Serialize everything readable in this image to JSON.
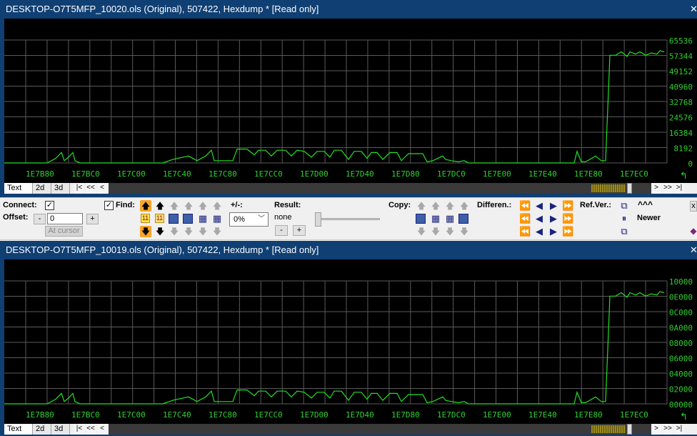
{
  "colors": {
    "title_bg": "#0f3f73",
    "graph_bg": "#000000",
    "grid": "#5a5a5a",
    "trace": "#22e022",
    "axis_text": "#2fd02f",
    "highlight": "#f7a52a",
    "navy": "#1a237e"
  },
  "panels": [
    {
      "title": "DESKTOP-O7T5MFP_10020.ols (Original), 507422, Hexdump *    [Read only]",
      "x_labels": [
        "1E7B80",
        "1E7BC0",
        "1E7C00",
        "1E7C40",
        "1E7C80",
        "1E7CC0",
        "1E7D00",
        "1E7D40",
        "1E7D80",
        "1E7DC0",
        "1E7E00",
        "1E7E40",
        "1E7E80",
        "1E7EC0"
      ],
      "y_labels": [
        "65536",
        "57344",
        "49152",
        "40960",
        "32768",
        "24576",
        "16384",
        "8192",
        "0"
      ],
      "tabs": [
        "Text",
        "2d",
        "3d"
      ]
    },
    {
      "title": "DESKTOP-O7T5MFP_10019.ols (Original), 507422, Hexdump *    [Read only]",
      "x_labels": [
        "1E7B80",
        "1E7BC0",
        "1E7C00",
        "1E7C40",
        "1E7C80",
        "1E7CC0",
        "1E7D00",
        "1E7D40",
        "1E7D80",
        "1E7DC0",
        "1E7E00",
        "1E7E40",
        "1E7E80",
        "1E7EC0"
      ],
      "y_labels": [
        "10000",
        "0E000",
        "0C000",
        "0A000",
        "08000",
        "06000",
        "04000",
        "02000",
        "00000"
      ],
      "tabs": [
        "Text",
        "2d",
        "3d"
      ]
    }
  ],
  "nav": {
    "first": "|<",
    "prev": "<<",
    "back": "<",
    "fwd": ">",
    "next": ">>",
    "last": ">|"
  },
  "toolbar": {
    "connect_label": "Connect:",
    "connect_checked": "✓",
    "offset_label": "Offset:",
    "offset_minus": "-",
    "offset_value": "0",
    "offset_plus": "+",
    "at_cursor": "At cursor",
    "find_checked": "✓",
    "find_label": "Find:",
    "find_num1": "11",
    "find_num2": "11",
    "plusminus_label": "+/-:",
    "percent_value": "0%",
    "result_label": "Result:",
    "result_value": "none",
    "result_minus": "-",
    "result_plus": "+",
    "copy_label": "Copy:",
    "differen_label": "Differen.:",
    "refver_label": "Ref.Ver.:",
    "refver_up": "^^^",
    "newer_label": "Newer",
    "close_label": "x"
  }
}
